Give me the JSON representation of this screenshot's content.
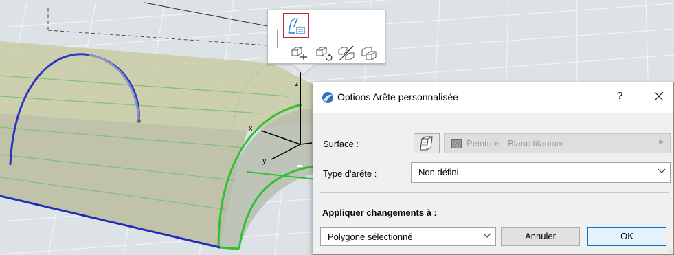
{
  "viewport": {
    "axis_labels": {
      "x": "x",
      "y": "y",
      "z": "z"
    },
    "colors": {
      "background": "#d7dde2",
      "grid": "#f1f3f5",
      "body_fill": "#c5c8a6",
      "arc_blue": "#2a36b8",
      "edge_green": "#39c43a"
    }
  },
  "pet_palette": {
    "main_tool_icon": "custom-edge-settings-icon",
    "highlight_color": "#c0272d",
    "tools": [
      "move-icon",
      "rotate-icon",
      "mirror-icon",
      "offset-copy-icon"
    ]
  },
  "dialog": {
    "title": "Options Arête personnalisée",
    "help": "?",
    "close": "X",
    "surface": {
      "label": "Surface :",
      "value": "Peinture - Blanc titanium",
      "enabled": false
    },
    "edge_type": {
      "label": "Type d'arête :",
      "value": "Non défini"
    },
    "apply": {
      "heading": "Appliquer changements à :",
      "value": "Polygone sélectionné"
    },
    "buttons": {
      "cancel": "Annuler",
      "ok": "OK"
    }
  }
}
